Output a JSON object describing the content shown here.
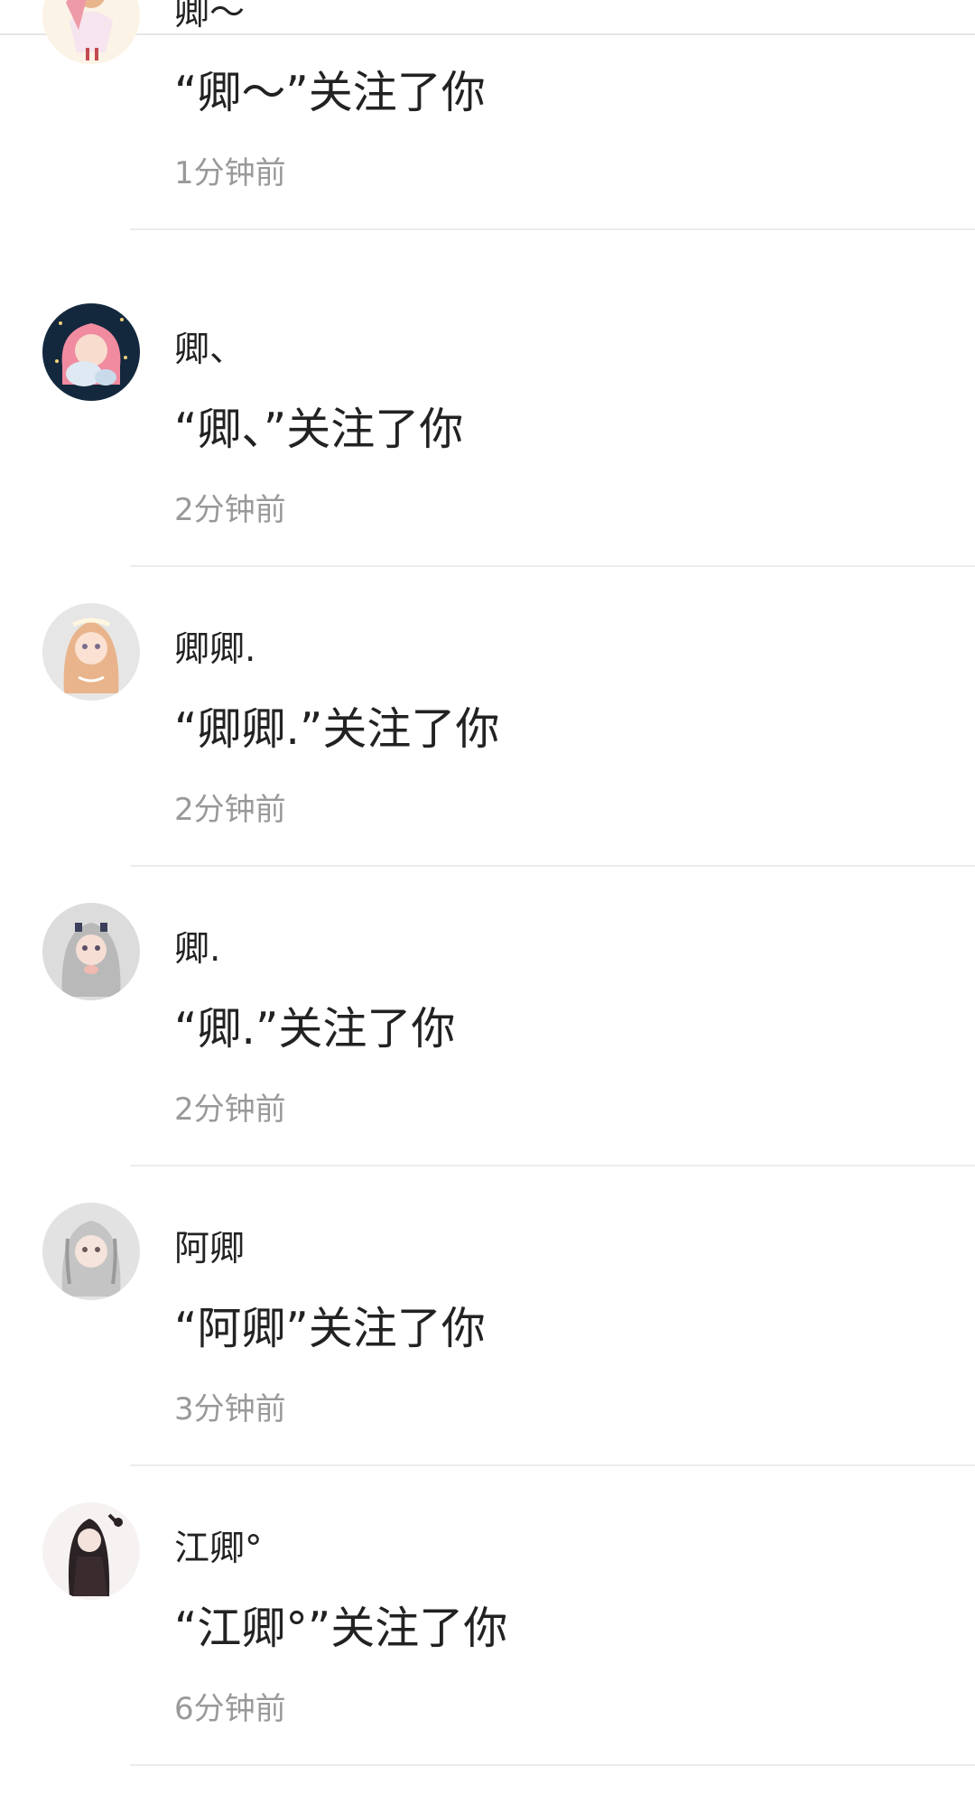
{
  "notifications": [
    {
      "name": "卿～",
      "message": "“卿～”关注了你",
      "time": "1分钟前",
      "avatar": "avatar-girl-white-dress-icon"
    },
    {
      "name": "卿、",
      "message": "“卿、”关注了你",
      "time": "2分钟前",
      "avatar": "avatar-pink-hair-girl-icon"
    },
    {
      "name": "卿卿.",
      "message": "“卿卿.”关注了你",
      "time": "2分钟前",
      "avatar": "avatar-blonde-girl-icon"
    },
    {
      "name": "卿.",
      "message": "“卿.”关注了你",
      "time": "2分钟前",
      "avatar": "avatar-silver-hair-girl-icon"
    },
    {
      "name": "阿卿",
      "message": "“阿卿”关注了你",
      "time": "3分钟前",
      "avatar": "avatar-grey-hair-girl-icon"
    },
    {
      "name": "江卿°",
      "message": "“江卿°”关注了你",
      "time": "6分钟前",
      "avatar": "avatar-dark-hair-girl-icon"
    }
  ]
}
